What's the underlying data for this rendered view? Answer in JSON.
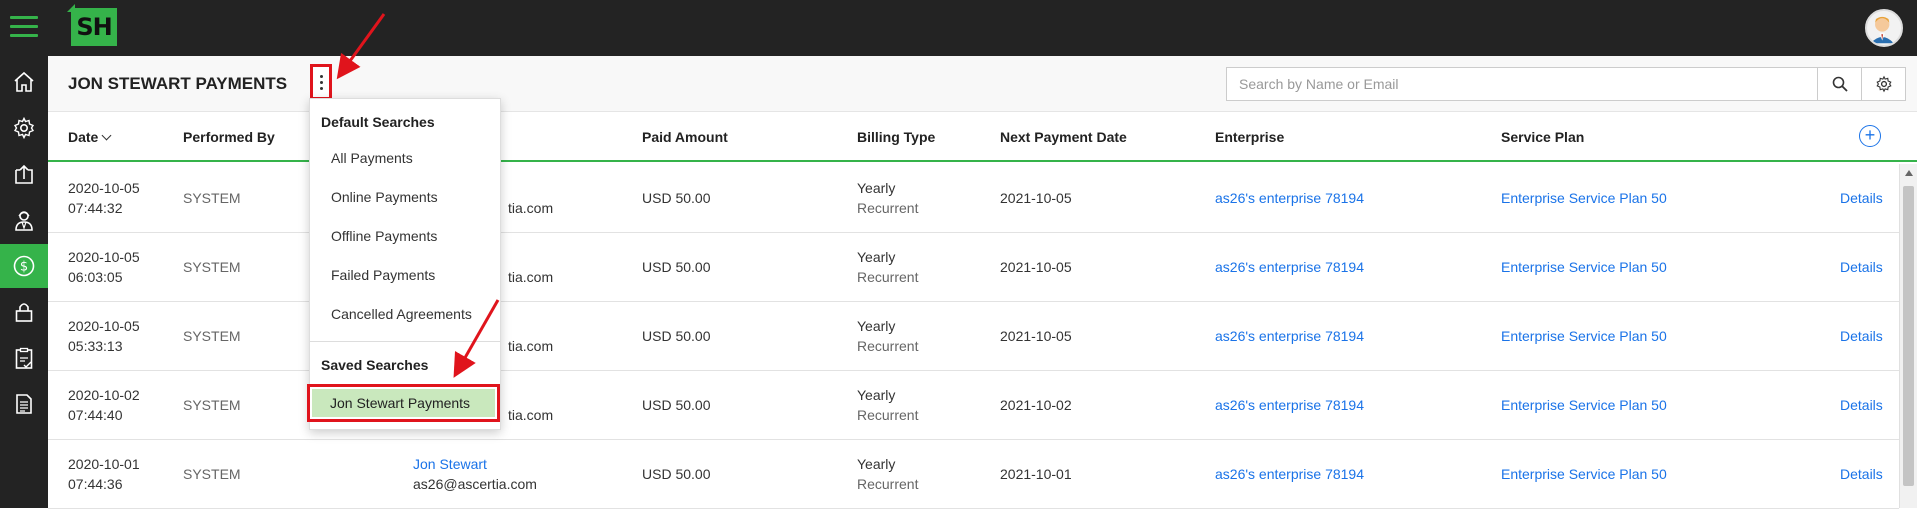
{
  "app": {
    "logo_text": "SH",
    "accent_color": "#35b34a",
    "link_color": "#1a73e8",
    "highlight_color": "#e0141c"
  },
  "sidebar": {
    "items": [
      {
        "icon": "home-icon",
        "active": false
      },
      {
        "icon": "gear-icon",
        "active": false
      },
      {
        "icon": "upload-box-icon",
        "active": false
      },
      {
        "icon": "user-agent-icon",
        "active": false
      },
      {
        "icon": "dollar-icon",
        "active": true
      },
      {
        "icon": "lock-icon",
        "active": false
      },
      {
        "icon": "clipboard-check-icon",
        "active": false
      },
      {
        "icon": "document-icon",
        "active": false
      }
    ]
  },
  "header": {
    "title": "JON STEWART PAYMENTS",
    "search_placeholder": "Search by Name or Email"
  },
  "table": {
    "columns": [
      "Date",
      "Performed By",
      "Paid Amount",
      "Billing Type",
      "Next Payment Date",
      "Enterprise",
      "Service Plan"
    ],
    "rows": [
      {
        "date": "2020-10-05",
        "time": "07:44:32",
        "performed_by": "SYSTEM",
        "email_tail": "tia.com",
        "amount": "USD 50.00",
        "billing": "Yearly",
        "billing_sub": "Recurrent",
        "next_date": "2021-10-05",
        "enterprise": "as26's enterprise 78194",
        "plan": "Enterprise Service Plan 50",
        "action": "Details"
      },
      {
        "date": "2020-10-05",
        "time": "06:03:05",
        "performed_by": "SYSTEM",
        "email_tail": "tia.com",
        "amount": "USD 50.00",
        "billing": "Yearly",
        "billing_sub": "Recurrent",
        "next_date": "2021-10-05",
        "enterprise": "as26's enterprise 78194",
        "plan": "Enterprise Service Plan 50",
        "action": "Details"
      },
      {
        "date": "2020-10-05",
        "time": "05:33:13",
        "performed_by": "SYSTEM",
        "email_tail": "tia.com",
        "amount": "USD 50.00",
        "billing": "Yearly",
        "billing_sub": "Recurrent",
        "next_date": "2021-10-05",
        "enterprise": "as26's enterprise 78194",
        "plan": "Enterprise Service Plan 50",
        "action": "Details"
      },
      {
        "date": "2020-10-02",
        "time": "07:44:40",
        "performed_by": "SYSTEM",
        "email_tail": "tia.com",
        "amount": "USD 50.00",
        "billing": "Yearly",
        "billing_sub": "Recurrent",
        "next_date": "2021-10-02",
        "enterprise": "as26's enterprise 78194",
        "plan": "Enterprise Service Plan 50",
        "action": "Details"
      },
      {
        "date": "2020-10-01",
        "time": "07:44:36",
        "performed_by": "SYSTEM",
        "name": "Jon Stewart",
        "email": "as26@ascertia.com",
        "amount": "USD 50.00",
        "billing": "Yearly",
        "billing_sub": "Recurrent",
        "next_date": "2021-10-01",
        "enterprise": "as26's enterprise 78194",
        "plan": "Enterprise Service Plan 50",
        "action": "Details"
      }
    ]
  },
  "dropdown": {
    "default_heading": "Default Searches",
    "default_items": [
      "All Payments",
      "Online Payments",
      "Offline Payments",
      "Failed Payments",
      "Cancelled Agreements"
    ],
    "saved_heading": "Saved Searches",
    "saved_items": [
      "Jon Stewart Payments"
    ]
  }
}
